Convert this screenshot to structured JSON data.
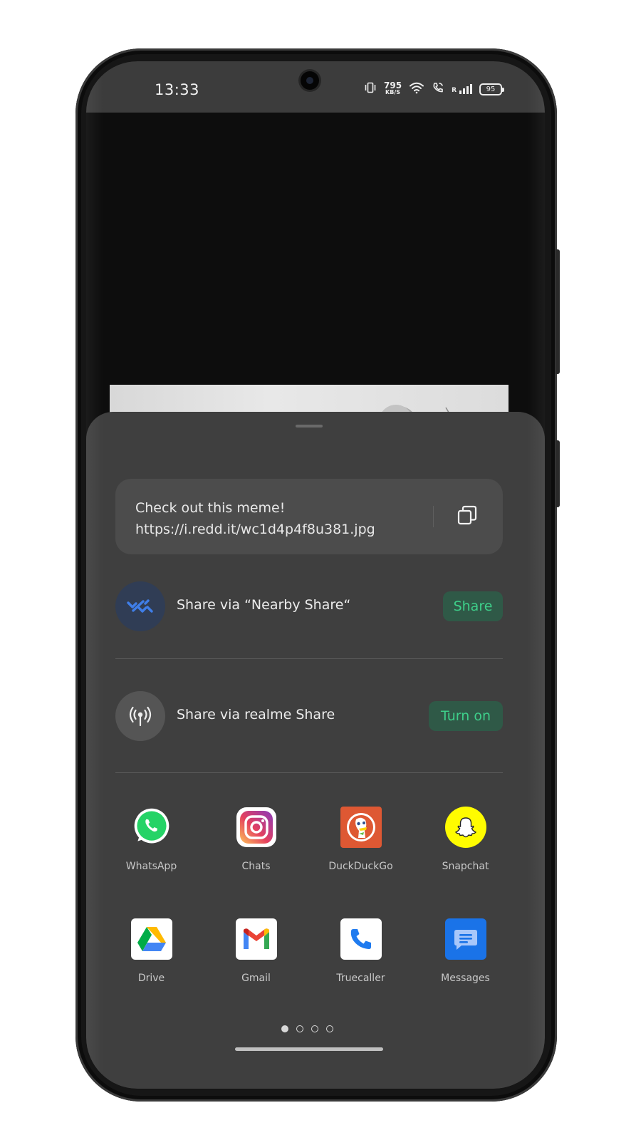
{
  "status_bar": {
    "time": "13:33",
    "net_speed_value": "795",
    "net_speed_unit": "KB/S",
    "roaming_label": "R",
    "battery": "95"
  },
  "share_sheet": {
    "link_text": "Check out this meme! https://i.redd.it/wc1d4p4f8u381.jpg",
    "nearby": {
      "label": "Share via “Nearby Share“",
      "button": "Share",
      "icon": "nearby-share-icon"
    },
    "realme": {
      "label": "Share via realme Share",
      "button": "Turn on",
      "icon": "realme-share-icon"
    },
    "apps": [
      {
        "label": "WhatsApp",
        "icon": "whatsapp-icon"
      },
      {
        "label": "Chats",
        "icon": "instagram-icon"
      },
      {
        "label": "DuckDuckGo",
        "icon": "duckduckgo-icon"
      },
      {
        "label": "Snapchat",
        "icon": "snapchat-icon"
      },
      {
        "label": "Drive",
        "icon": "google-drive-icon"
      },
      {
        "label": "Gmail",
        "icon": "gmail-icon"
      },
      {
        "label": "Truecaller",
        "icon": "truecaller-icon"
      },
      {
        "label": "Messages",
        "icon": "messages-icon"
      }
    ],
    "pagination": {
      "current": 1,
      "total": 4
    }
  },
  "colors": {
    "sheet_bg": "#3f3f3f",
    "accent_green": "#3ecf8a",
    "button_bg": "#2f5947"
  }
}
